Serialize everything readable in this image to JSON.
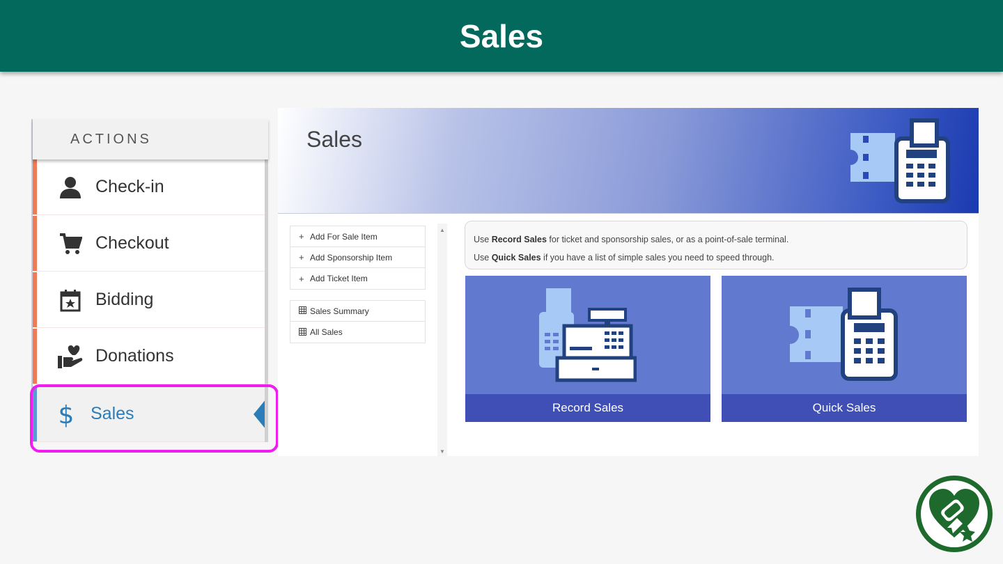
{
  "header": {
    "title": "Sales"
  },
  "sidebar": {
    "heading": "ACTIONS",
    "items": [
      {
        "label": "Check-in",
        "icon": "person-icon"
      },
      {
        "label": "Checkout",
        "icon": "cart-icon"
      },
      {
        "label": "Bidding",
        "icon": "calendar-star-icon"
      },
      {
        "label": "Donations",
        "icon": "hand-heart-icon"
      },
      {
        "label": "Sales",
        "icon": "dollar-icon",
        "active": true
      }
    ]
  },
  "panel": {
    "title": "Sales",
    "add_menu": [
      "Add For Sale Item",
      "Add Sponsorship Item",
      "Add Ticket Item"
    ],
    "report_menu": [
      "Sales Summary",
      "All Sales"
    ],
    "info": {
      "line1_pre": "Use ",
      "line1_bold": "Record Sales",
      "line1_post": " for ticket and sponsorship sales, or as a point-of-sale terminal.",
      "line2_pre": "Use ",
      "line2_bold": "Quick Sales",
      "line2_post": " if you have a list of simple sales you need to speed through."
    },
    "tiles": [
      {
        "label": "Record Sales",
        "icon": "cash-register-icon"
      },
      {
        "label": "Quick Sales",
        "icon": "ticket-terminal-icon"
      }
    ]
  },
  "colors": {
    "header_bg": "#02695c",
    "accent_orange": "#ee7a56",
    "active_blue": "#2a7db8",
    "highlight_magenta": "#f01cf0",
    "tile_bg": "#6279d0",
    "tile_caption": "#3f4fb6",
    "logo_green": "#1e6a2c"
  }
}
